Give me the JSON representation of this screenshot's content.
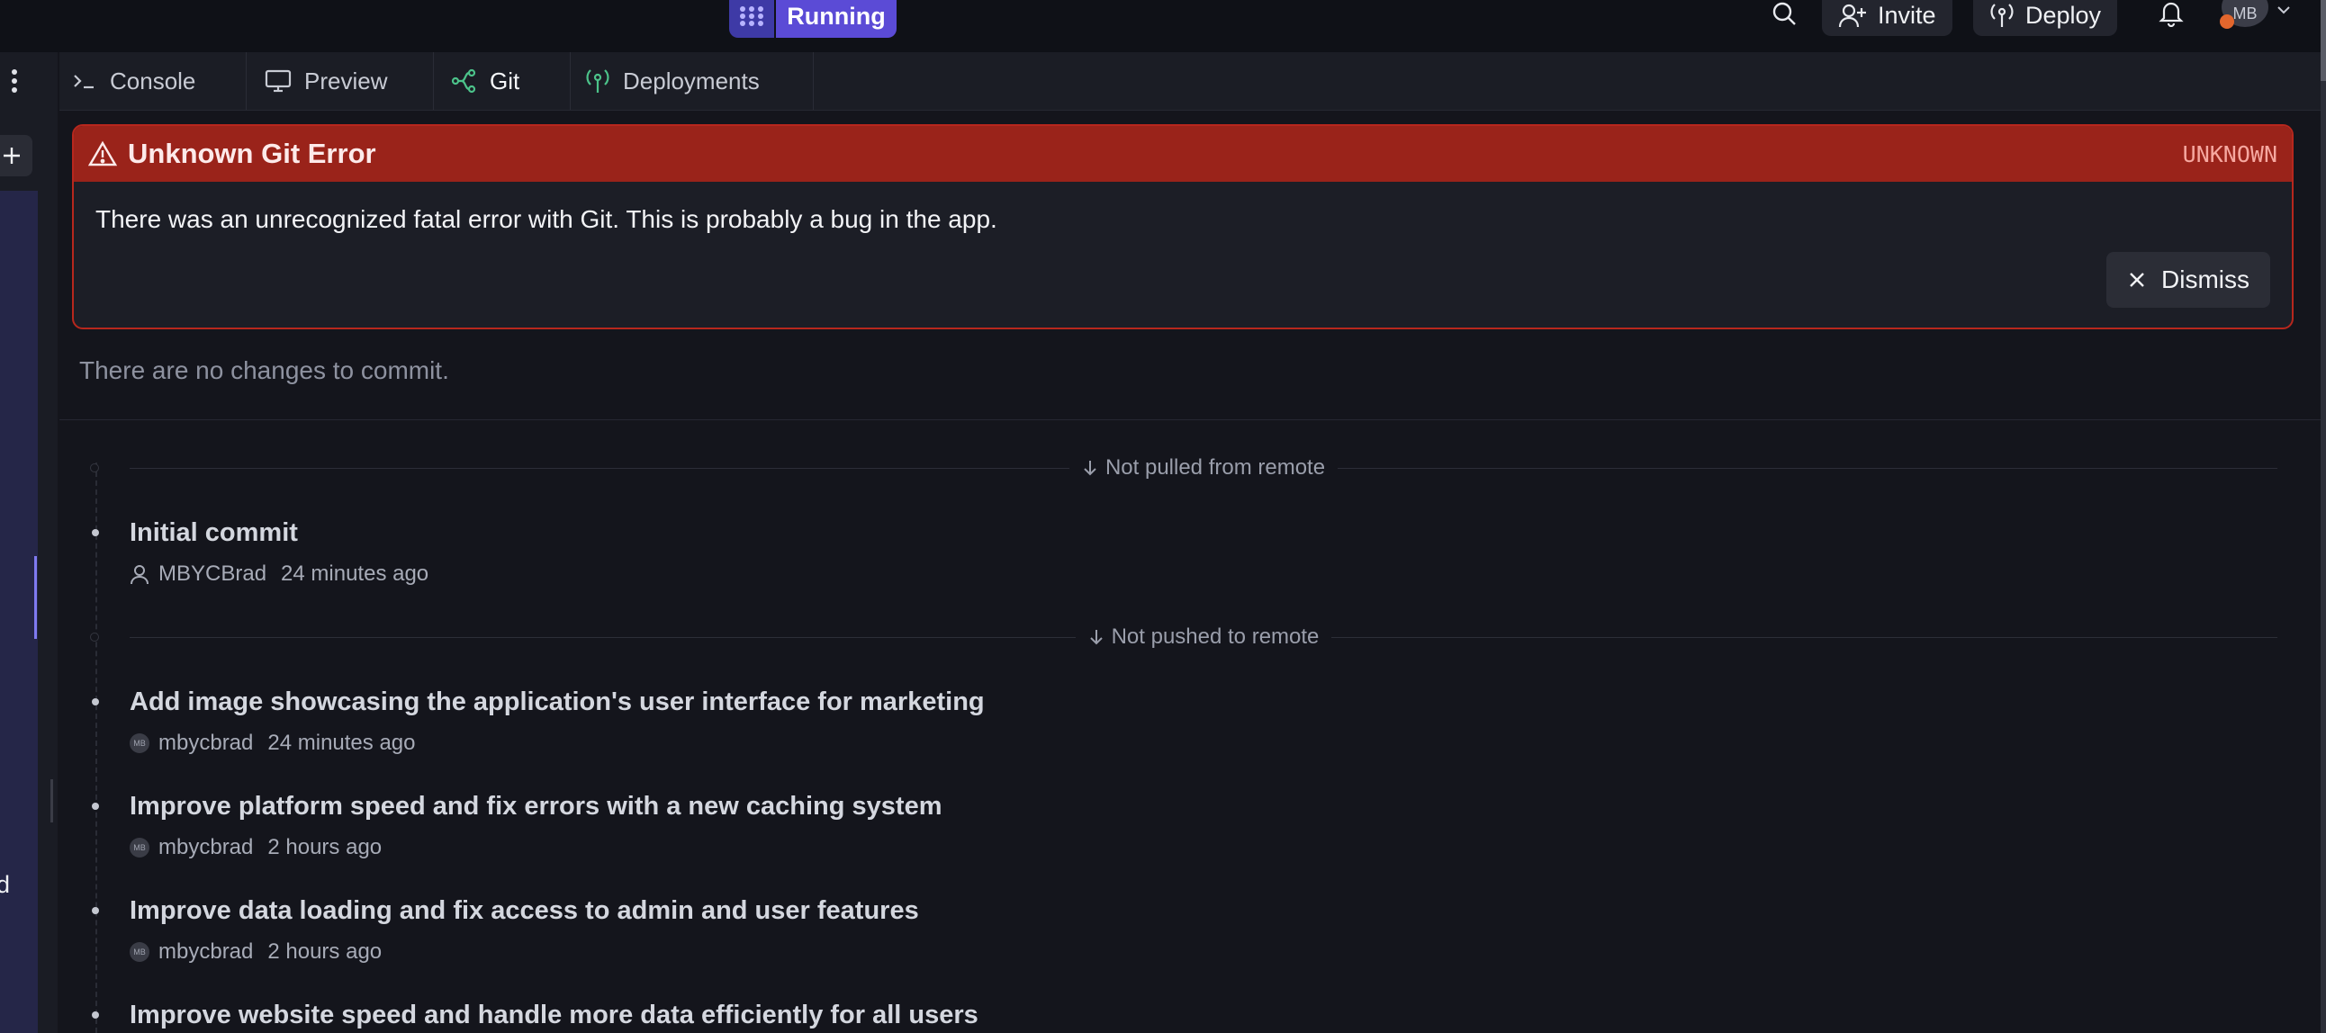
{
  "topbar": {
    "run_label": "Running",
    "invite_label": "Invite",
    "deploy_label": "Deploy",
    "avatar_initials": "MB"
  },
  "tabs": [
    {
      "label": "Console",
      "icon": "terminal-icon"
    },
    {
      "label": "Preview",
      "icon": "monitor-icon"
    },
    {
      "label": "Git",
      "icon": "git-branch-icon",
      "active": true
    },
    {
      "label": "Deployments",
      "icon": "deploy-icon"
    }
  ],
  "left": {
    "letter": "d"
  },
  "error": {
    "title": "Unknown Git Error",
    "code": "UNKNOWN",
    "message": "There was an unrecognized fatal error with Git. This is probably a bug in the app.",
    "dismiss_label": "Dismiss"
  },
  "status": {
    "no_changes": "There are no changes to commit."
  },
  "timeline": {
    "not_pulled_label": "Not pulled from remote",
    "not_pushed_label": "Not pushed to remote"
  },
  "commits": [
    {
      "title": "Initial commit",
      "author": "MBYCBrad",
      "time": "24 minutes ago",
      "avatar": "user-icon"
    },
    {
      "title": "Add image showcasing the application's user interface for marketing",
      "author": "mbycbrad",
      "time": "24 minutes ago",
      "avatar": "MB"
    },
    {
      "title": "Improve platform speed and fix errors with a new caching system",
      "author": "mbycbrad",
      "time": "2 hours ago",
      "avatar": "MB"
    },
    {
      "title": "Improve data loading and fix access to admin and user features",
      "author": "mbycbrad",
      "time": "2 hours ago",
      "avatar": "MB"
    },
    {
      "title": "Improve website speed and handle more data efficiently for all users",
      "author": "",
      "time": "",
      "avatar": ""
    }
  ],
  "colors": {
    "accent": "#5b4bd6",
    "error_header": "#9a231a",
    "error_border": "#b7271d",
    "git_icon": "#4cc38a"
  }
}
